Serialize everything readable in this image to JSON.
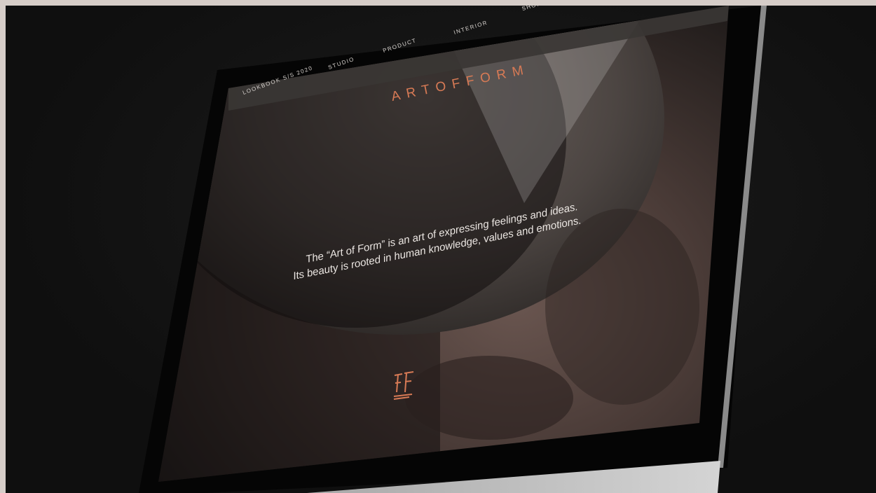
{
  "nav": {
    "items": [
      "LOOKBOOK S/S 2020",
      "STUDIO",
      "PRODUCT",
      "INTERIOR",
      "SHOP"
    ]
  },
  "brand": {
    "name": "ARTOFFORM",
    "accent_color": "#d77a55"
  },
  "hero": {
    "line1": "The “Art of Form” is an art of expressing feelings and ideas.",
    "line2": "Its beauty is rooted in human knowledge, values and emotions."
  },
  "logo": {
    "icon": "af-monogram-icon"
  }
}
